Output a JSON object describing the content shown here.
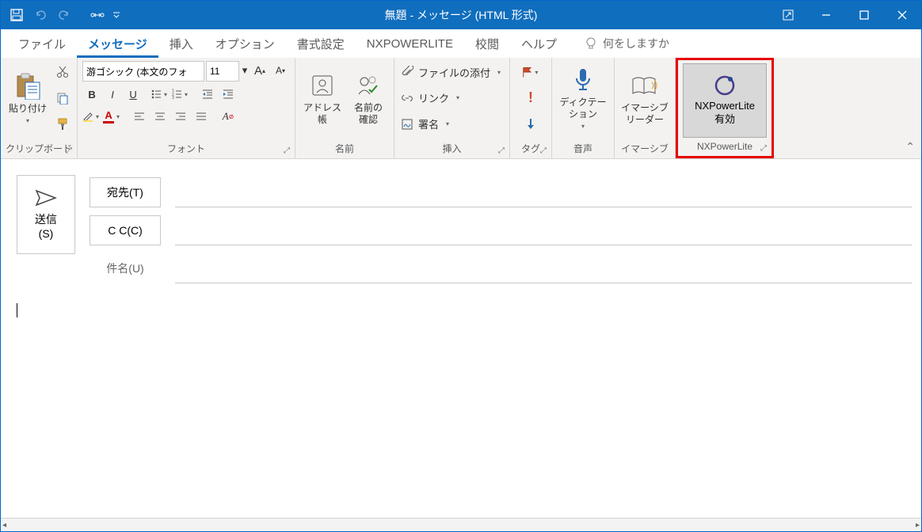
{
  "title": "無題  -  メッセージ (HTML 形式)",
  "tabs": {
    "file": "ファイル",
    "message": "メッセージ",
    "insert": "挿入",
    "options": "オプション",
    "format": "書式設定",
    "nxp": "NXPOWERLITE",
    "review": "校閲",
    "help": "ヘルプ"
  },
  "tell_me": "何をしますか",
  "ribbon": {
    "clipboard": {
      "paste": "貼り付け",
      "label": "クリップボード"
    },
    "font": {
      "family": "游ゴシック (本文のフォ",
      "size": "11",
      "label": "フォント"
    },
    "names": {
      "address_book": "アドレス帳",
      "check_names": "名前の\n確認",
      "label": "名前"
    },
    "insert": {
      "attach_file": "ファイルの添付",
      "link": "リンク",
      "signature": "署名",
      "label": "挿入"
    },
    "tags": {
      "label": "タグ"
    },
    "voice": {
      "dictation": "ディクテー\nション",
      "label": "音声"
    },
    "immersive": {
      "reader": "イマーシブ\nリーダー",
      "label": "イマーシブ"
    },
    "nxp_group": {
      "button": "NXPowerLite\n有効",
      "label": "NXPowerLite"
    }
  },
  "compose": {
    "send": "送信\n(S)",
    "to": "宛先(T)",
    "cc": "C C(C)",
    "subject_label": "件名(U)",
    "subject_value": ""
  }
}
